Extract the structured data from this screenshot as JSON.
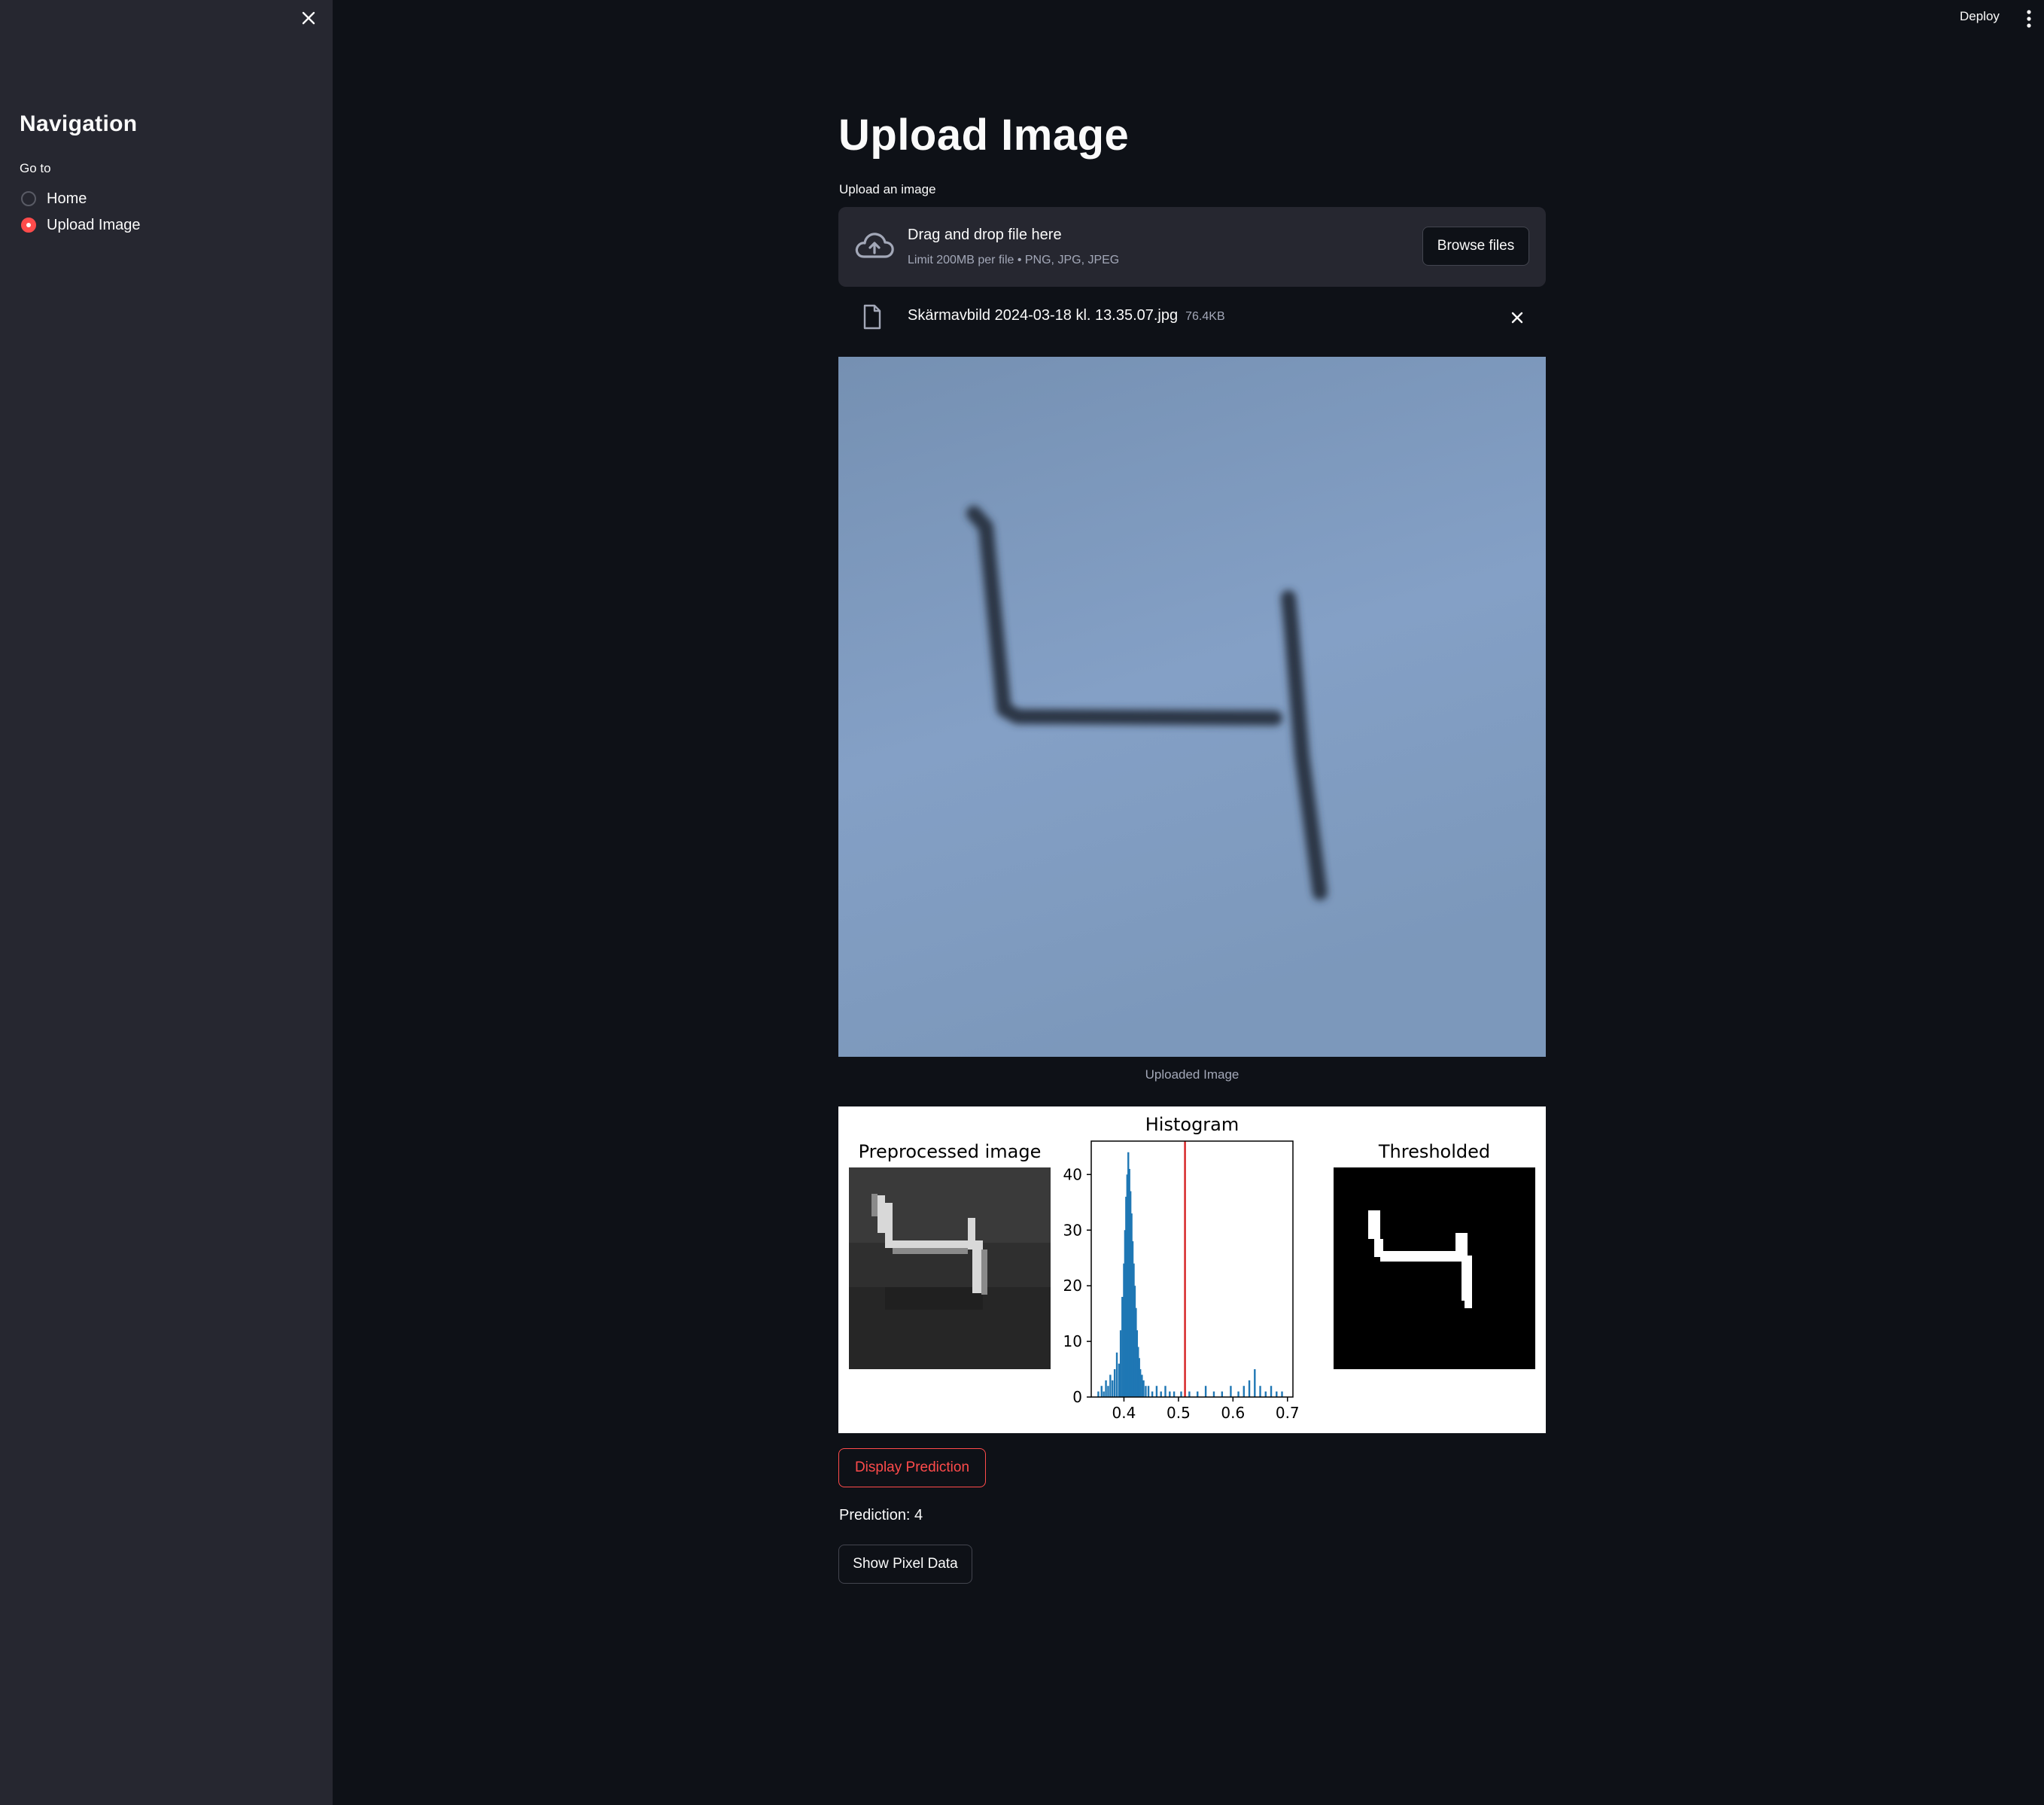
{
  "sidebar": {
    "title": "Navigation",
    "goto_label": "Go to",
    "options": [
      {
        "label": "Home",
        "selected": false
      },
      {
        "label": "Upload Image",
        "selected": true
      }
    ]
  },
  "header": {
    "deploy_label": "Deploy"
  },
  "main": {
    "title": "Upload Image",
    "uploader_label": "Upload an image",
    "dropzone": {
      "title": "Drag and drop file here",
      "subtitle": "Limit 200MB per file • PNG, JPG, JPEG",
      "browse_label": "Browse files"
    },
    "file": {
      "name": "Skärmavbild 2024-03-18 kl. 13.35.07.jpg",
      "size": "76.4KB"
    },
    "image_caption": "Uploaded Image",
    "plots": {
      "left_title": "Preprocessed image",
      "middle_title": "Histogram",
      "right_title": "Thresholded"
    },
    "predict_label": "Display Prediction",
    "prediction_text": "Prediction: 4",
    "pixel_label": "Show Pixel Data"
  },
  "colors": {
    "accent": "#ff4b4b",
    "background": "#0e1117",
    "sidebar": "#262730",
    "histogram_bar": "#1f77b4",
    "threshold_line": "#d62728"
  },
  "chart_data": {
    "type": "bar",
    "title": "Histogram",
    "xlabel": "",
    "ylabel": "",
    "xlim": [
      0.34,
      0.71
    ],
    "ylim": [
      0,
      46
    ],
    "xticks": [
      0.4,
      0.5,
      0.6,
      0.7
    ],
    "yticks": [
      0,
      10,
      20,
      30,
      40
    ],
    "threshold": 0.512,
    "bins": [
      [
        0.353,
        1
      ],
      [
        0.359,
        2
      ],
      [
        0.363,
        1
      ],
      [
        0.367,
        3
      ],
      [
        0.371,
        2
      ],
      [
        0.375,
        4
      ],
      [
        0.379,
        3
      ],
      [
        0.383,
        5
      ],
      [
        0.387,
        8
      ],
      [
        0.391,
        6
      ],
      [
        0.394,
        12
      ],
      [
        0.397,
        18
      ],
      [
        0.4,
        24
      ],
      [
        0.402,
        30
      ],
      [
        0.404,
        36
      ],
      [
        0.406,
        40
      ],
      [
        0.408,
        44
      ],
      [
        0.41,
        41
      ],
      [
        0.412,
        37
      ],
      [
        0.414,
        33
      ],
      [
        0.416,
        28
      ],
      [
        0.418,
        24
      ],
      [
        0.42,
        20
      ],
      [
        0.422,
        16
      ],
      [
        0.424,
        12
      ],
      [
        0.426,
        9
      ],
      [
        0.428,
        7
      ],
      [
        0.43,
        5
      ],
      [
        0.433,
        4
      ],
      [
        0.436,
        3
      ],
      [
        0.44,
        2
      ],
      [
        0.445,
        2
      ],
      [
        0.452,
        1
      ],
      [
        0.46,
        2
      ],
      [
        0.468,
        1
      ],
      [
        0.476,
        2
      ],
      [
        0.484,
        1
      ],
      [
        0.492,
        1
      ],
      [
        0.505,
        1
      ],
      [
        0.52,
        1
      ],
      [
        0.535,
        1
      ],
      [
        0.55,
        2
      ],
      [
        0.565,
        1
      ],
      [
        0.58,
        1
      ],
      [
        0.596,
        2
      ],
      [
        0.61,
        1
      ],
      [
        0.62,
        2
      ],
      [
        0.63,
        3
      ],
      [
        0.64,
        5
      ],
      [
        0.65,
        2
      ],
      [
        0.66,
        1
      ],
      [
        0.67,
        2
      ],
      [
        0.68,
        1
      ],
      [
        0.69,
        1
      ]
    ]
  }
}
